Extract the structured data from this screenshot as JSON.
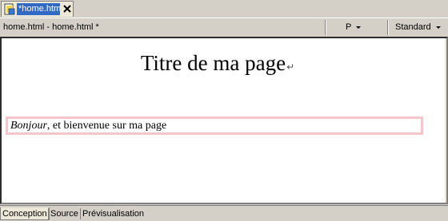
{
  "tab": {
    "title": "*home.html",
    "icon": "dreamweaver-file-icon",
    "close_icon": "close-icon"
  },
  "toolbar": {
    "doc_path": "home.html - home.html *",
    "format_value": "P",
    "style_value": "Standard"
  },
  "document": {
    "heading": "Titre de ma page",
    "paragraph_italic": "Bonjour",
    "paragraph_rest": ", et bienvenue sur ma page"
  },
  "view_tabs": [
    {
      "label": "Conception",
      "active": true
    },
    {
      "label": "Source",
      "active": false
    },
    {
      "label": "Prévisualisation",
      "active": false
    }
  ],
  "colors": {
    "tab_highlight": "#316ac5",
    "paragraph_outline": "#f7c4cc",
    "chrome": "#d4d0c8"
  }
}
